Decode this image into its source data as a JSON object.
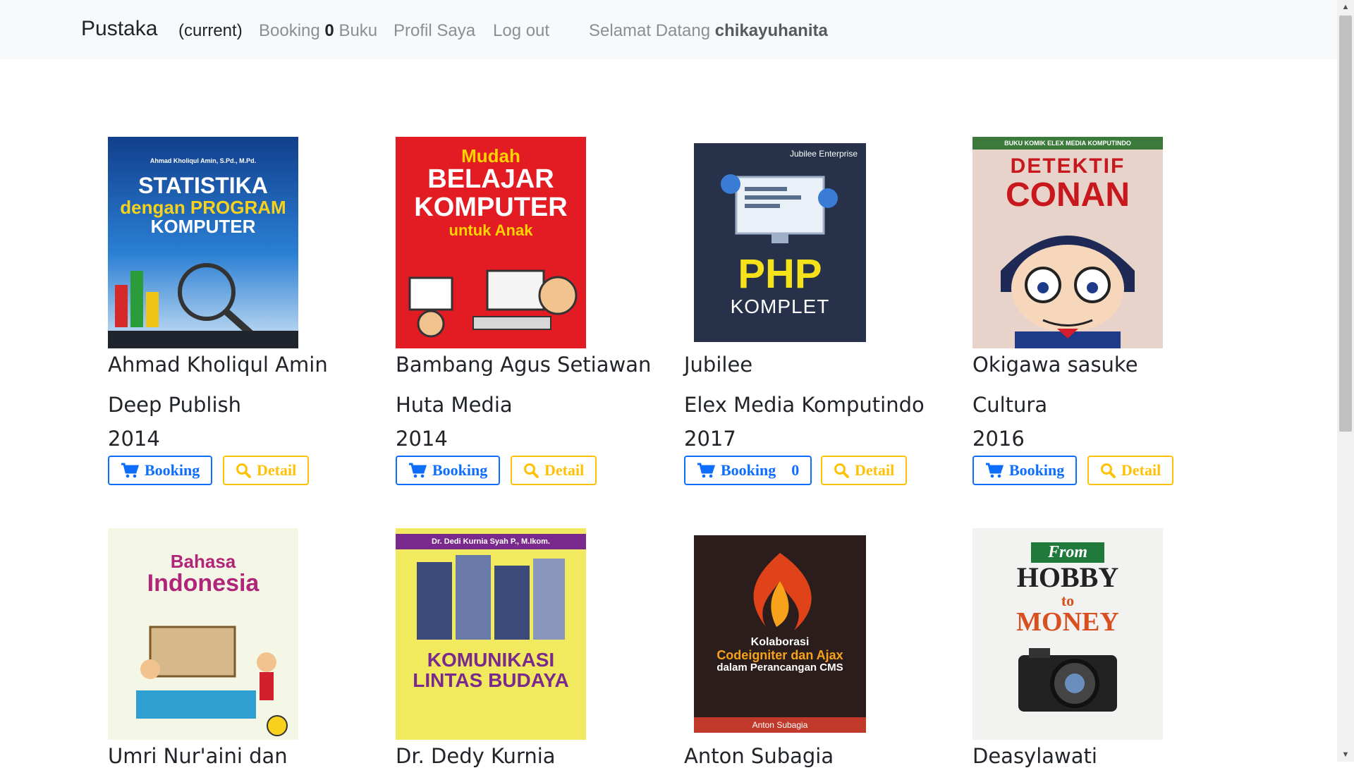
{
  "navbar": {
    "brand": "Pustaka",
    "current": "(current)",
    "booking_prefix": "Booking",
    "booking_count": "0",
    "booking_suffix": "Buku",
    "profile": "Profil Saya",
    "logout": "Log out",
    "welcome_prefix": "Selamat Datang",
    "username": "chikayuhanita"
  },
  "buttons": {
    "booking_label": "Booking",
    "detail_label": "Detail"
  },
  "books": [
    {
      "author": "Ahmad Kholiqul Amin",
      "publisher": "Deep Publish",
      "year": "2014",
      "booking_count": "",
      "cover": {
        "small": "Ahmad Kholiqul Amin, S.Pd., M.Pd.",
        "title": "STATISTIKA",
        "title2": "dengan PROGRAM",
        "title3": "KOMPUTER",
        "bg": "#1d5fb8",
        "fg": "#ffffff",
        "accent": "#f7d11c"
      }
    },
    {
      "author": "Bambang Agus Setiawan",
      "publisher": "Huta Media",
      "year": "2014",
      "booking_count": "",
      "cover": {
        "small": "Mudah",
        "title": "BELAJAR",
        "title2": "KOMPUTER",
        "title3": "untuk Anak",
        "bg": "#e31b23",
        "fg": "#ffffff",
        "accent": "#ffd400"
      }
    },
    {
      "author": "Jubilee",
      "publisher": "Elex Media Komputindo",
      "year": "2017",
      "booking_count": "0",
      "cover": {
        "small": "Jubilee Enterprise",
        "title": "PHP",
        "title2": "KOMPLET",
        "title3": "",
        "bg": "#27324a",
        "fg": "#ffffff",
        "accent": "#f5e21a"
      }
    },
    {
      "author": "Okigawa sasuke",
      "publisher": "Cultura",
      "year": "2016",
      "booking_count": "",
      "cover": {
        "small": "BUKU KOMIK ELEX MEDIA KOMPUTINDO",
        "title": "DETEKTIF",
        "title2": "CONAN",
        "title3": "",
        "bg": "#e7d3c9",
        "fg": "#c9171e",
        "accent": "#1e3b8a"
      }
    },
    {
      "author": "Umri Nur'aini dan",
      "publisher": "",
      "year": "",
      "booking_count": "",
      "cover": {
        "small": "",
        "title": "Bahasa",
        "title2": "Indonesia",
        "title3": "",
        "bg": "#f4f7e6",
        "fg": "#b0247a",
        "accent": "#2f9ed1"
      }
    },
    {
      "author": "Dr. Dedy Kurnia",
      "publisher": "",
      "year": "",
      "booking_count": "",
      "cover": {
        "small": "Dr. Dedi Kurnia Syah P., M.Ikom.",
        "title": "KOMUNIKASI",
        "title2": "LINTAS BUDAYA",
        "title3": "",
        "bg": "#f1ea5e",
        "fg": "#7a2a8c",
        "accent": "#3a4a7a"
      }
    },
    {
      "author": "Anton Subagia",
      "publisher": "",
      "year": "",
      "booking_count": "",
      "cover": {
        "small": "Kolaborasi",
        "title": "Codeigniter dan Ajax",
        "title2": "dalam Perancangan CMS",
        "title3": "Anton Subagia",
        "bg": "#2b1d1b",
        "fg": "#ffffff",
        "accent": "#f7a21a"
      }
    },
    {
      "author": "Deasylawati",
      "publisher": "",
      "year": "",
      "booking_count": "",
      "cover": {
        "small": "From",
        "title": "HOBBY",
        "title2": "to",
        "title3": "MONEY",
        "bg": "#f2f2f0",
        "fg": "#222222",
        "accent": "#d8501f"
      }
    }
  ],
  "colors": {
    "primary": "#0d6efd",
    "warning": "#ffc107",
    "navbar_bg": "#f8f9fa"
  }
}
